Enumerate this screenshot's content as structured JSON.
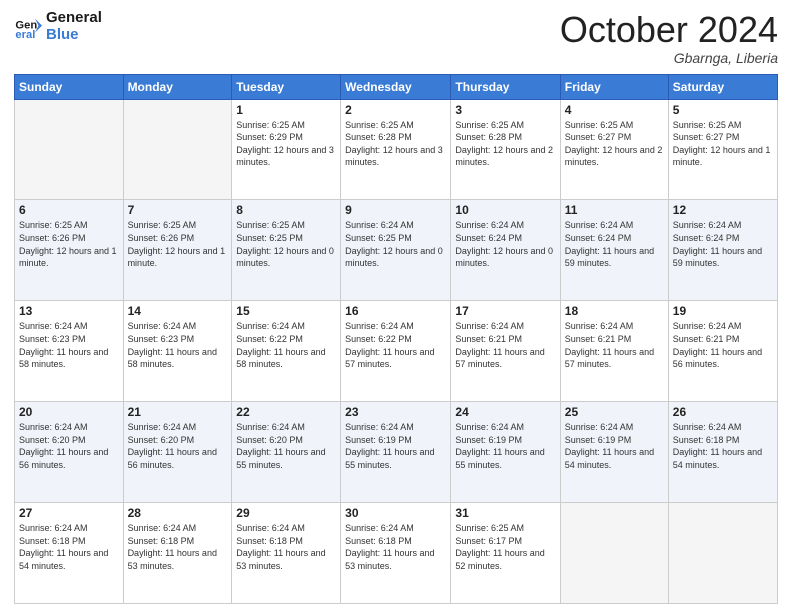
{
  "logo": {
    "text_general": "General",
    "text_blue": "Blue"
  },
  "header": {
    "month": "October 2024",
    "location": "Gbarnga, Liberia"
  },
  "days_of_week": [
    "Sunday",
    "Monday",
    "Tuesday",
    "Wednesday",
    "Thursday",
    "Friday",
    "Saturday"
  ],
  "weeks": [
    [
      {
        "day": "",
        "sunrise": "",
        "sunset": "",
        "daylight": "",
        "empty": true
      },
      {
        "day": "",
        "sunrise": "",
        "sunset": "",
        "daylight": "",
        "empty": true
      },
      {
        "day": "1",
        "sunrise": "Sunrise: 6:25 AM",
        "sunset": "Sunset: 6:29 PM",
        "daylight": "Daylight: 12 hours and 3 minutes.",
        "empty": false
      },
      {
        "day": "2",
        "sunrise": "Sunrise: 6:25 AM",
        "sunset": "Sunset: 6:28 PM",
        "daylight": "Daylight: 12 hours and 3 minutes.",
        "empty": false
      },
      {
        "day": "3",
        "sunrise": "Sunrise: 6:25 AM",
        "sunset": "Sunset: 6:28 PM",
        "daylight": "Daylight: 12 hours and 2 minutes.",
        "empty": false
      },
      {
        "day": "4",
        "sunrise": "Sunrise: 6:25 AM",
        "sunset": "Sunset: 6:27 PM",
        "daylight": "Daylight: 12 hours and 2 minutes.",
        "empty": false
      },
      {
        "day": "5",
        "sunrise": "Sunrise: 6:25 AM",
        "sunset": "Sunset: 6:27 PM",
        "daylight": "Daylight: 12 hours and 1 minute.",
        "empty": false
      }
    ],
    [
      {
        "day": "6",
        "sunrise": "Sunrise: 6:25 AM",
        "sunset": "Sunset: 6:26 PM",
        "daylight": "Daylight: 12 hours and 1 minute.",
        "empty": false
      },
      {
        "day": "7",
        "sunrise": "Sunrise: 6:25 AM",
        "sunset": "Sunset: 6:26 PM",
        "daylight": "Daylight: 12 hours and 1 minute.",
        "empty": false
      },
      {
        "day": "8",
        "sunrise": "Sunrise: 6:25 AM",
        "sunset": "Sunset: 6:25 PM",
        "daylight": "Daylight: 12 hours and 0 minutes.",
        "empty": false
      },
      {
        "day": "9",
        "sunrise": "Sunrise: 6:24 AM",
        "sunset": "Sunset: 6:25 PM",
        "daylight": "Daylight: 12 hours and 0 minutes.",
        "empty": false
      },
      {
        "day": "10",
        "sunrise": "Sunrise: 6:24 AM",
        "sunset": "Sunset: 6:24 PM",
        "daylight": "Daylight: 12 hours and 0 minutes.",
        "empty": false
      },
      {
        "day": "11",
        "sunrise": "Sunrise: 6:24 AM",
        "sunset": "Sunset: 6:24 PM",
        "daylight": "Daylight: 11 hours and 59 minutes.",
        "empty": false
      },
      {
        "day": "12",
        "sunrise": "Sunrise: 6:24 AM",
        "sunset": "Sunset: 6:24 PM",
        "daylight": "Daylight: 11 hours and 59 minutes.",
        "empty": false
      }
    ],
    [
      {
        "day": "13",
        "sunrise": "Sunrise: 6:24 AM",
        "sunset": "Sunset: 6:23 PM",
        "daylight": "Daylight: 11 hours and 58 minutes.",
        "empty": false
      },
      {
        "day": "14",
        "sunrise": "Sunrise: 6:24 AM",
        "sunset": "Sunset: 6:23 PM",
        "daylight": "Daylight: 11 hours and 58 minutes.",
        "empty": false
      },
      {
        "day": "15",
        "sunrise": "Sunrise: 6:24 AM",
        "sunset": "Sunset: 6:22 PM",
        "daylight": "Daylight: 11 hours and 58 minutes.",
        "empty": false
      },
      {
        "day": "16",
        "sunrise": "Sunrise: 6:24 AM",
        "sunset": "Sunset: 6:22 PM",
        "daylight": "Daylight: 11 hours and 57 minutes.",
        "empty": false
      },
      {
        "day": "17",
        "sunrise": "Sunrise: 6:24 AM",
        "sunset": "Sunset: 6:21 PM",
        "daylight": "Daylight: 11 hours and 57 minutes.",
        "empty": false
      },
      {
        "day": "18",
        "sunrise": "Sunrise: 6:24 AM",
        "sunset": "Sunset: 6:21 PM",
        "daylight": "Daylight: 11 hours and 57 minutes.",
        "empty": false
      },
      {
        "day": "19",
        "sunrise": "Sunrise: 6:24 AM",
        "sunset": "Sunset: 6:21 PM",
        "daylight": "Daylight: 11 hours and 56 minutes.",
        "empty": false
      }
    ],
    [
      {
        "day": "20",
        "sunrise": "Sunrise: 6:24 AM",
        "sunset": "Sunset: 6:20 PM",
        "daylight": "Daylight: 11 hours and 56 minutes.",
        "empty": false
      },
      {
        "day": "21",
        "sunrise": "Sunrise: 6:24 AM",
        "sunset": "Sunset: 6:20 PM",
        "daylight": "Daylight: 11 hours and 56 minutes.",
        "empty": false
      },
      {
        "day": "22",
        "sunrise": "Sunrise: 6:24 AM",
        "sunset": "Sunset: 6:20 PM",
        "daylight": "Daylight: 11 hours and 55 minutes.",
        "empty": false
      },
      {
        "day": "23",
        "sunrise": "Sunrise: 6:24 AM",
        "sunset": "Sunset: 6:19 PM",
        "daylight": "Daylight: 11 hours and 55 minutes.",
        "empty": false
      },
      {
        "day": "24",
        "sunrise": "Sunrise: 6:24 AM",
        "sunset": "Sunset: 6:19 PM",
        "daylight": "Daylight: 11 hours and 55 minutes.",
        "empty": false
      },
      {
        "day": "25",
        "sunrise": "Sunrise: 6:24 AM",
        "sunset": "Sunset: 6:19 PM",
        "daylight": "Daylight: 11 hours and 54 minutes.",
        "empty": false
      },
      {
        "day": "26",
        "sunrise": "Sunrise: 6:24 AM",
        "sunset": "Sunset: 6:18 PM",
        "daylight": "Daylight: 11 hours and 54 minutes.",
        "empty": false
      }
    ],
    [
      {
        "day": "27",
        "sunrise": "Sunrise: 6:24 AM",
        "sunset": "Sunset: 6:18 PM",
        "daylight": "Daylight: 11 hours and 54 minutes.",
        "empty": false
      },
      {
        "day": "28",
        "sunrise": "Sunrise: 6:24 AM",
        "sunset": "Sunset: 6:18 PM",
        "daylight": "Daylight: 11 hours and 53 minutes.",
        "empty": false
      },
      {
        "day": "29",
        "sunrise": "Sunrise: 6:24 AM",
        "sunset": "Sunset: 6:18 PM",
        "daylight": "Daylight: 11 hours and 53 minutes.",
        "empty": false
      },
      {
        "day": "30",
        "sunrise": "Sunrise: 6:24 AM",
        "sunset": "Sunset: 6:18 PM",
        "daylight": "Daylight: 11 hours and 53 minutes.",
        "empty": false
      },
      {
        "day": "31",
        "sunrise": "Sunrise: 6:25 AM",
        "sunset": "Sunset: 6:17 PM",
        "daylight": "Daylight: 11 hours and 52 minutes.",
        "empty": false
      },
      {
        "day": "",
        "sunrise": "",
        "sunset": "",
        "daylight": "",
        "empty": true
      },
      {
        "day": "",
        "sunrise": "",
        "sunset": "",
        "daylight": "",
        "empty": true
      }
    ]
  ]
}
